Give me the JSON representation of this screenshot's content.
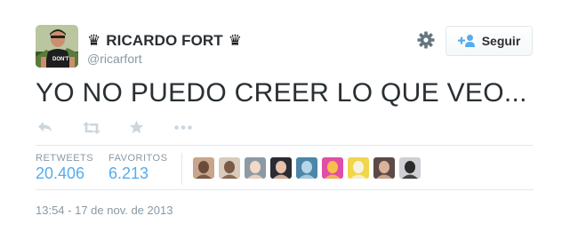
{
  "user": {
    "fullname": "RICARDO FORT",
    "crown_left": "♛",
    "crown_right": "♛",
    "username": "@ricarfort"
  },
  "follow_button": {
    "label": "Seguir",
    "icon": "add-user-icon"
  },
  "settings_icon": "gear-icon",
  "tweet": {
    "text": "YO NO PUEDO CREER LO QUE VEO..."
  },
  "actions": {
    "reply_icon": "reply-icon",
    "retweet_icon": "retweet-icon",
    "favorite_icon": "star-icon",
    "more_icon": "more-icon"
  },
  "stats": {
    "retweets_label": "RETWEETS",
    "retweets_value": "20.406",
    "favorites_label": "FAVORITOS",
    "favorites_value": "6.213"
  },
  "favoriter_avatars": [
    {
      "bg": "#c8a58c",
      "fg": "#6b4c3b"
    },
    {
      "bg": "#d9cbbd",
      "fg": "#7a5a44"
    },
    {
      "bg": "#8c9aa3",
      "fg": "#f3d9c9"
    },
    {
      "bg": "#2b2b33",
      "fg": "#e7c2ad"
    },
    {
      "bg": "#4c86a8",
      "fg": "#b7d6e8"
    },
    {
      "bg": "#e04ea6",
      "fg": "#f6c04b"
    },
    {
      "bg": "#f0d64a",
      "fg": "#f7f2e0"
    },
    {
      "bg": "#5b4a45",
      "fg": "#d9b39c"
    },
    {
      "bg": "#cfcfd4",
      "fg": "#2a2a2a"
    }
  ],
  "timestamp": "13:54 - 17 de nov. de 2013",
  "colors": {
    "link": "#55acee",
    "muted": "#8899a6",
    "border": "#e1e8ed",
    "text": "#292f33"
  }
}
